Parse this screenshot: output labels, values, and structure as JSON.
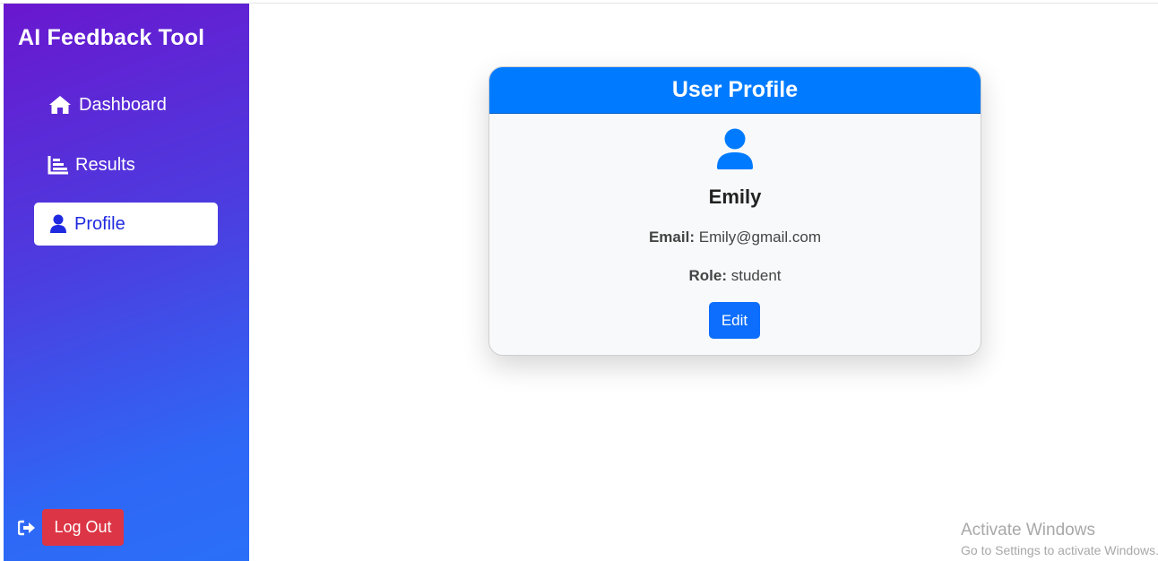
{
  "sidebar": {
    "brand": "AI Feedback Tool",
    "items": [
      {
        "label": "Dashboard",
        "icon": "home-icon",
        "active": false
      },
      {
        "label": "Results",
        "icon": "chart-icon",
        "active": false
      },
      {
        "label": "Profile",
        "icon": "user-icon",
        "active": true
      }
    ],
    "logout_label": "Log Out",
    "logout_icon": "sign-out-icon"
  },
  "profile_card": {
    "title": "User Profile",
    "avatar_icon": "user-icon",
    "name": "Emily",
    "email_label": "Email:",
    "email_value": "Emily@gmail.com",
    "role_label": "Role:",
    "role_value": "student",
    "edit_label": "Edit"
  },
  "watermark": {
    "line1": "Activate Windows",
    "line2": "Go to Settings to activate Windows."
  },
  "colors": {
    "sidebar_gradient_start": "#6a17cf",
    "sidebar_gradient_end": "#2a6ff8",
    "card_header": "#007bff",
    "edit_button": "#0d6efd",
    "logout_button": "#dc3545",
    "active_nav_text": "#1f2ae0"
  }
}
